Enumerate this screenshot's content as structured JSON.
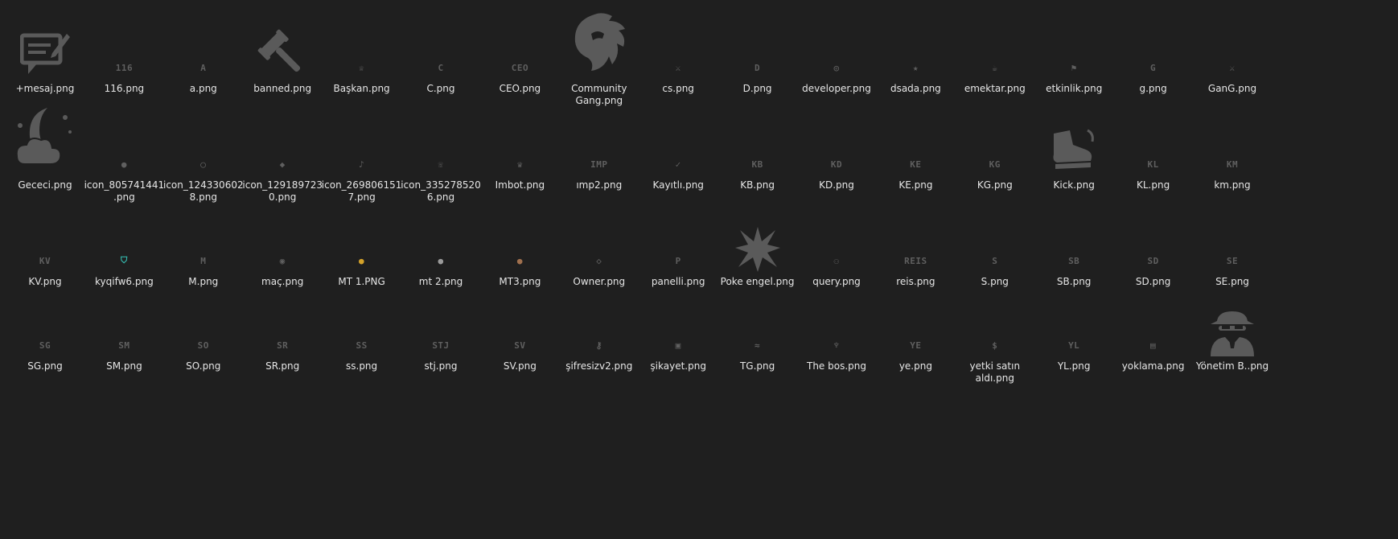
{
  "files": [
    {
      "name": "+mesaj.png",
      "icon": "message-edit-icon",
      "kind": "big"
    },
    {
      "name": "116.png",
      "icon": "116-badge-icon",
      "mini": "116"
    },
    {
      "name": "a.png",
      "icon": "a-badge-icon",
      "mini": "A"
    },
    {
      "name": "banned.png",
      "icon": "gavel-icon",
      "kind": "big"
    },
    {
      "name": "Başkan.png",
      "icon": "crown-outline-icon",
      "mini": "♕"
    },
    {
      "name": "C.png",
      "icon": "c-badge-icon",
      "mini": "C"
    },
    {
      "name": "CEO.png",
      "icon": "ceo-badge-icon",
      "mini": "CEO"
    },
    {
      "name": "Community Gang.png",
      "icon": "lion-head-icon",
      "kind": "big"
    },
    {
      "name": "cs.png",
      "icon": "running-soldier-icon",
      "mini": "⚔"
    },
    {
      "name": "D.png",
      "icon": "d-badge-icon",
      "mini": "D"
    },
    {
      "name": "developer.png",
      "icon": "brain-icon",
      "mini": "◎"
    },
    {
      "name": "dsada.png",
      "icon": "star-icon",
      "mini": "★"
    },
    {
      "name": "emektar.png",
      "icon": "coffee-cup-icon",
      "mini": "☕"
    },
    {
      "name": "etkinlik.png",
      "icon": "people-icon",
      "mini": "⚑"
    },
    {
      "name": "g.png",
      "icon": "g-badge-icon",
      "mini": "G"
    },
    {
      "name": "GanG.png",
      "icon": "gang-figure-icon",
      "mini": "⚔"
    },
    {
      "name": "Gececi.png",
      "icon": "moon-cloud-icon",
      "kind": "big"
    },
    {
      "name": "icon_805741441.png",
      "icon": "user-icon",
      "mini": "●"
    },
    {
      "name": "icon_1243306028.png",
      "icon": "whatsapp-icon",
      "mini": "◯"
    },
    {
      "name": "icon_1291897230.png",
      "icon": "tag-icon",
      "mini": "◆"
    },
    {
      "name": "icon_2698061517.png",
      "icon": "music-note-icon",
      "mini": "♪"
    },
    {
      "name": "icon_3352785206.png",
      "icon": "phone-call-icon",
      "mini": "☏"
    },
    {
      "name": "Imbot.png",
      "icon": "crown-icon",
      "mini": "♛"
    },
    {
      "name": "ımp2.png",
      "icon": "imp-badge-icon",
      "mini": "IMP"
    },
    {
      "name": "Kayıtlı.png",
      "icon": "checkmark-icon",
      "mini": "✓"
    },
    {
      "name": "KB.png",
      "icon": "kb-badge-icon",
      "mini": "KB"
    },
    {
      "name": "KD.png",
      "icon": "kd-badge-icon",
      "mini": "KD"
    },
    {
      "name": "KE.png",
      "icon": "ke-badge-icon",
      "mini": "KE"
    },
    {
      "name": "KG.png",
      "icon": "kg-badge-icon",
      "mini": "KG"
    },
    {
      "name": "Kick.png",
      "icon": "boot-kick-icon",
      "kind": "big"
    },
    {
      "name": "KL.png",
      "icon": "kl-badge-icon",
      "mini": "KL"
    },
    {
      "name": "km.png",
      "icon": "km-badge-icon",
      "mini": "KM"
    },
    {
      "name": "KV.png",
      "icon": "kv-badge-icon",
      "mini": "KV"
    },
    {
      "name": "kyqifw6.png",
      "icon": "shield-teal-icon",
      "mini": "⛉",
      "color": "#35c0b5"
    },
    {
      "name": "M.png",
      "icon": "m-badge-icon",
      "mini": "M"
    },
    {
      "name": "maç.png",
      "icon": "ball-icon",
      "mini": "◉"
    },
    {
      "name": "MT 1.PNG",
      "icon": "gold-medal-icon",
      "mini": "●",
      "color": "#d4a22a"
    },
    {
      "name": "mt 2.png",
      "icon": "silver-medal-icon",
      "mini": "●",
      "color": "#9a9a9a"
    },
    {
      "name": "MT3.png",
      "icon": "bronze-medal-icon",
      "mini": "●",
      "color": "#a0704e"
    },
    {
      "name": "Owner.png",
      "icon": "diamond-icon",
      "mini": "◇"
    },
    {
      "name": "panelli.png",
      "icon": "p-badge-icon",
      "mini": "P"
    },
    {
      "name": "Poke engel.png",
      "icon": "starburst-icon",
      "kind": "big"
    },
    {
      "name": "query.png",
      "icon": "users-search-icon",
      "mini": "⚇"
    },
    {
      "name": "reis.png",
      "icon": "reis-badge-icon",
      "mini": "REIS"
    },
    {
      "name": "S.png",
      "icon": "s-badge-icon",
      "mini": "S"
    },
    {
      "name": "SB.png",
      "icon": "sb-badge-icon",
      "mini": "SB"
    },
    {
      "name": "SD.png",
      "icon": "sd-badge-icon",
      "mini": "SD"
    },
    {
      "name": "SE.png",
      "icon": "se-badge-icon",
      "mini": "SE"
    },
    {
      "name": "SG.png",
      "icon": "sg-badge-icon",
      "mini": "SG"
    },
    {
      "name": "SM.png",
      "icon": "sm-badge-icon",
      "mini": "SM"
    },
    {
      "name": "SO.png",
      "icon": "so-badge-icon",
      "mini": "SO"
    },
    {
      "name": "SR.png",
      "icon": "sr-badge-icon",
      "mini": "SR"
    },
    {
      "name": "ss.png",
      "icon": "ss-badge-icon",
      "mini": "SS"
    },
    {
      "name": "stj.png",
      "icon": "stj-badge-icon",
      "mini": "STJ"
    },
    {
      "name": "SV.png",
      "icon": "sv-badge-icon",
      "mini": "SV"
    },
    {
      "name": "şifresizv2.png",
      "icon": "key-icon",
      "mini": "⚷"
    },
    {
      "name": "şikayet.png",
      "icon": "complaint-form-icon",
      "mini": "▣"
    },
    {
      "name": "TG.png",
      "icon": "mustache-icon",
      "mini": "≈"
    },
    {
      "name": "The bos.png",
      "icon": "eagle-icon",
      "mini": "♆"
    },
    {
      "name": "ye.png",
      "icon": "ye-badge-icon",
      "mini": "YE"
    },
    {
      "name": "yetki satın aldı.png",
      "icon": "money-bag-icon",
      "mini": "$"
    },
    {
      "name": "YL.png",
      "icon": "yl-badge-icon",
      "mini": "YL"
    },
    {
      "name": "yoklama.png",
      "icon": "attendance-icon",
      "mini": "▤"
    },
    {
      "name": "Yönetim B..png",
      "icon": "spy-agent-icon",
      "kind": "big"
    }
  ],
  "colors": {
    "background": "#1f1f1f",
    "label": "#e6e6e6",
    "badge": "#5f5f5f",
    "thumb": "#5a5a5a"
  }
}
